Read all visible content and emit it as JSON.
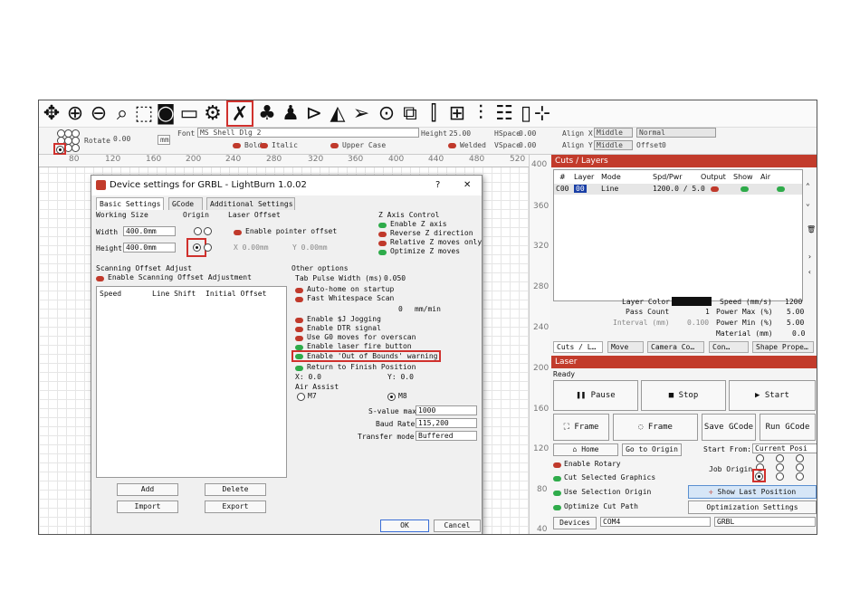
{
  "options_bar": {
    "rotate_label": "Rotate",
    "rotate_value": "0.00",
    "unit": "mm",
    "font_label": "Font",
    "font_value": "MS Shell Dlg 2",
    "height_label": "Height",
    "height_value": "25.00",
    "hspace_label": "HSpace",
    "hspace_value": "0.00",
    "bold": "Bold",
    "italic": "Italic",
    "upper_case": "Upper Case",
    "welded": "Welded",
    "vspace_label": "VSpace",
    "vspace_value": "0.00",
    "align_x_label": "Align X",
    "align_x_value": "Middle",
    "align_y_label": "Align Y",
    "align_y_value": "Middle",
    "normal_value": "Normal",
    "offset_label": "Offset",
    "offset_value": "0"
  },
  "ruler": {
    "top_ticks": [
      "80",
      "120",
      "160",
      "200",
      "240",
      "280",
      "320",
      "360",
      "400",
      "440",
      "480",
      "520"
    ],
    "right_ticks": [
      "400",
      "360",
      "320",
      "280",
      "240",
      "200",
      "160",
      "120",
      "80",
      "40"
    ]
  },
  "dialog": {
    "title": "Device settings for GRBL - LightBurn 1.0.02",
    "help": "?",
    "close": "✕",
    "tabs": [
      "Basic Settings",
      "GCode",
      "Additional Settings"
    ],
    "working_size_title": "Working Size",
    "width_label": "Width",
    "width_value": "400.0mm",
    "height_label": "Height",
    "height_value": "400.0mm",
    "origin_title": "Origin",
    "laser_offset_title": "Laser Offset",
    "enable_pointer_offset": "Enable pointer offset",
    "x_offset": "X 0.00mm",
    "y_offset": "Y 0.00mm",
    "z_axis_title": "Z Axis Control",
    "z_items": [
      "Enable Z axis",
      "Reverse Z direction",
      "Relative Z moves only",
      "Optimize Z moves"
    ],
    "scan_offset_title": "Scanning Offset Adjust",
    "enable_scan_offset": "Enable Scanning Offset Adjustment",
    "scan_columns": [
      "Speed",
      "Line Shift",
      "Initial Offset"
    ],
    "add_button": "Add",
    "delete_button": "Delete",
    "import_button": "Import",
    "export_button": "Export",
    "other_options_title": "Other options",
    "tab_pulse_label": "Tab Pulse Width (ms)",
    "tab_pulse_value": "0.050",
    "auto_home": "Auto-home on startup",
    "fast_whitespace": "Fast Whitespace Scan",
    "whitespace_value": "0",
    "whitespace_unit": "mm/min",
    "other_items": [
      "Enable $J Jogging",
      "Enable DTR signal",
      "Use G0 moves for overscan",
      "Enable laser fire button",
      "Enable 'Out of Bounds' warning",
      "Return to Finish Position"
    ],
    "finish_x": "X: 0.0",
    "finish_y": "Y: 0.0",
    "air_assist_title": "Air Assist",
    "air_m7": "M7",
    "air_m8": "M8",
    "s_value_label": "S-value max",
    "s_value": "1000",
    "baud_label": "Baud Rate",
    "baud_value": "115,200",
    "transfer_label": "Transfer mode",
    "transfer_value": "Buffered",
    "ok_button": "OK",
    "cancel_button": "Cancel"
  },
  "cuts_panel": {
    "title": "Cuts / Layers",
    "columns": [
      "#",
      "Layer",
      "Mode",
      "Spd/Pwr",
      "Output",
      "Show",
      "Air"
    ],
    "row": {
      "id": "C00",
      "layer": "00",
      "mode": "Line",
      "spd_pwr": "1200.0 / 5.0"
    },
    "layer_color_label": "Layer Color",
    "pass_count_label": "Pass Count",
    "pass_count_value": "1",
    "interval_label": "Interval (mm)",
    "interval_value": "0.100",
    "speed_label": "Speed (mm/s)",
    "speed_value": "1200",
    "power_max_label": "Power Max (%)",
    "power_max_value": "5.00",
    "power_min_label": "Power Min (%)",
    "power_min_value": "5.00",
    "material_label": "Material (mm)",
    "material_value": "0.0",
    "tabs": [
      "Cuts / L…",
      "Move",
      "Camera Co…",
      "Con…",
      "Shape Prope…"
    ]
  },
  "laser_panel": {
    "title": "Laser",
    "status": "Ready",
    "pause": "Pause",
    "stop": "Stop",
    "start": "Start",
    "frame1": "Frame",
    "frame2": "Frame",
    "save_gcode": "Save GCode",
    "run_gcode": "Run GCode",
    "home": "Home",
    "go_to_origin": "Go to Origin",
    "start_from_label": "Start From:",
    "start_from_value": "Current Posi",
    "enable_rotary": "Enable Rotary",
    "cut_selected": "Cut Selected Graphics",
    "use_selection_origin": "Use Selection Origin",
    "optimize_cut_path": "Optimize Cut Path",
    "job_origin_label": "Job Origin",
    "show_last_position": "Show Last Position",
    "optimization_settings": "Optimization Settings",
    "devices_button": "Devices",
    "port_value": "COM4",
    "device_value": "GRBL"
  },
  "colors": {
    "accent": "#c23b2b",
    "highlight": "#d0312d",
    "toggle_on": "#2eab4a",
    "toggle_off": "#c0392b",
    "selected_row": "#3b6fd6"
  }
}
